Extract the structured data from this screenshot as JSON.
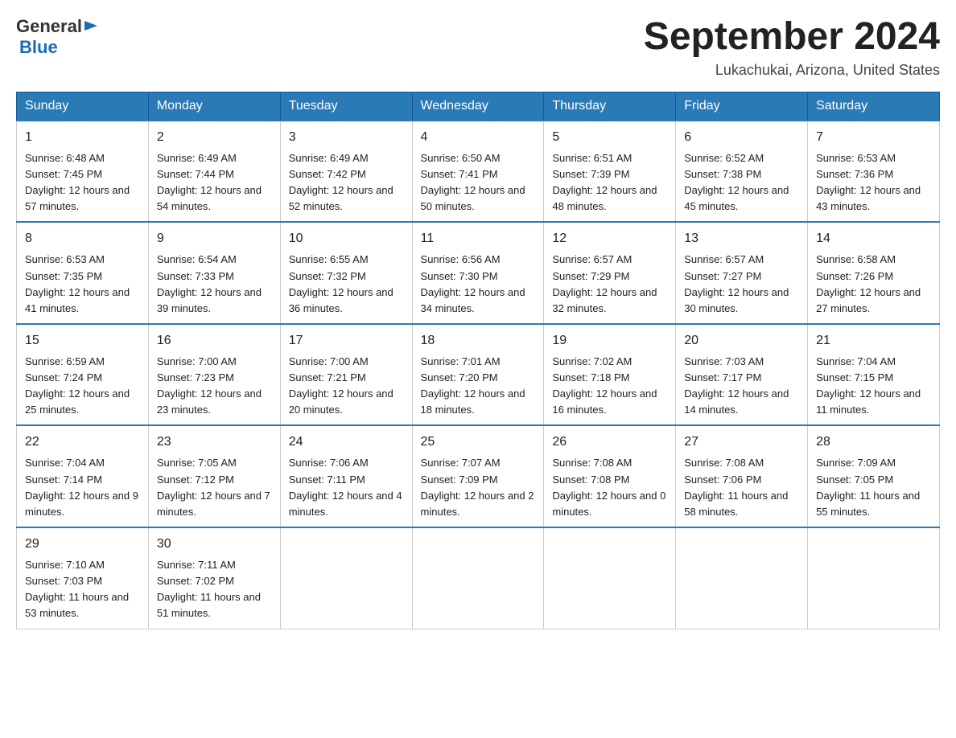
{
  "header": {
    "logo_general": "General",
    "logo_blue": "Blue",
    "title": "September 2024",
    "subtitle": "Lukachukai, Arizona, United States"
  },
  "weekdays": [
    "Sunday",
    "Monday",
    "Tuesday",
    "Wednesday",
    "Thursday",
    "Friday",
    "Saturday"
  ],
  "weeks": [
    [
      {
        "day": "1",
        "sunrise": "Sunrise: 6:48 AM",
        "sunset": "Sunset: 7:45 PM",
        "daylight": "Daylight: 12 hours and 57 minutes."
      },
      {
        "day": "2",
        "sunrise": "Sunrise: 6:49 AM",
        "sunset": "Sunset: 7:44 PM",
        "daylight": "Daylight: 12 hours and 54 minutes."
      },
      {
        "day": "3",
        "sunrise": "Sunrise: 6:49 AM",
        "sunset": "Sunset: 7:42 PM",
        "daylight": "Daylight: 12 hours and 52 minutes."
      },
      {
        "day": "4",
        "sunrise": "Sunrise: 6:50 AM",
        "sunset": "Sunset: 7:41 PM",
        "daylight": "Daylight: 12 hours and 50 minutes."
      },
      {
        "day": "5",
        "sunrise": "Sunrise: 6:51 AM",
        "sunset": "Sunset: 7:39 PM",
        "daylight": "Daylight: 12 hours and 48 minutes."
      },
      {
        "day": "6",
        "sunrise": "Sunrise: 6:52 AM",
        "sunset": "Sunset: 7:38 PM",
        "daylight": "Daylight: 12 hours and 45 minutes."
      },
      {
        "day": "7",
        "sunrise": "Sunrise: 6:53 AM",
        "sunset": "Sunset: 7:36 PM",
        "daylight": "Daylight: 12 hours and 43 minutes."
      }
    ],
    [
      {
        "day": "8",
        "sunrise": "Sunrise: 6:53 AM",
        "sunset": "Sunset: 7:35 PM",
        "daylight": "Daylight: 12 hours and 41 minutes."
      },
      {
        "day": "9",
        "sunrise": "Sunrise: 6:54 AM",
        "sunset": "Sunset: 7:33 PM",
        "daylight": "Daylight: 12 hours and 39 minutes."
      },
      {
        "day": "10",
        "sunrise": "Sunrise: 6:55 AM",
        "sunset": "Sunset: 7:32 PM",
        "daylight": "Daylight: 12 hours and 36 minutes."
      },
      {
        "day": "11",
        "sunrise": "Sunrise: 6:56 AM",
        "sunset": "Sunset: 7:30 PM",
        "daylight": "Daylight: 12 hours and 34 minutes."
      },
      {
        "day": "12",
        "sunrise": "Sunrise: 6:57 AM",
        "sunset": "Sunset: 7:29 PM",
        "daylight": "Daylight: 12 hours and 32 minutes."
      },
      {
        "day": "13",
        "sunrise": "Sunrise: 6:57 AM",
        "sunset": "Sunset: 7:27 PM",
        "daylight": "Daylight: 12 hours and 30 minutes."
      },
      {
        "day": "14",
        "sunrise": "Sunrise: 6:58 AM",
        "sunset": "Sunset: 7:26 PM",
        "daylight": "Daylight: 12 hours and 27 minutes."
      }
    ],
    [
      {
        "day": "15",
        "sunrise": "Sunrise: 6:59 AM",
        "sunset": "Sunset: 7:24 PM",
        "daylight": "Daylight: 12 hours and 25 minutes."
      },
      {
        "day": "16",
        "sunrise": "Sunrise: 7:00 AM",
        "sunset": "Sunset: 7:23 PM",
        "daylight": "Daylight: 12 hours and 23 minutes."
      },
      {
        "day": "17",
        "sunrise": "Sunrise: 7:00 AM",
        "sunset": "Sunset: 7:21 PM",
        "daylight": "Daylight: 12 hours and 20 minutes."
      },
      {
        "day": "18",
        "sunrise": "Sunrise: 7:01 AM",
        "sunset": "Sunset: 7:20 PM",
        "daylight": "Daylight: 12 hours and 18 minutes."
      },
      {
        "day": "19",
        "sunrise": "Sunrise: 7:02 AM",
        "sunset": "Sunset: 7:18 PM",
        "daylight": "Daylight: 12 hours and 16 minutes."
      },
      {
        "day": "20",
        "sunrise": "Sunrise: 7:03 AM",
        "sunset": "Sunset: 7:17 PM",
        "daylight": "Daylight: 12 hours and 14 minutes."
      },
      {
        "day": "21",
        "sunrise": "Sunrise: 7:04 AM",
        "sunset": "Sunset: 7:15 PM",
        "daylight": "Daylight: 12 hours and 11 minutes."
      }
    ],
    [
      {
        "day": "22",
        "sunrise": "Sunrise: 7:04 AM",
        "sunset": "Sunset: 7:14 PM",
        "daylight": "Daylight: 12 hours and 9 minutes."
      },
      {
        "day": "23",
        "sunrise": "Sunrise: 7:05 AM",
        "sunset": "Sunset: 7:12 PM",
        "daylight": "Daylight: 12 hours and 7 minutes."
      },
      {
        "day": "24",
        "sunrise": "Sunrise: 7:06 AM",
        "sunset": "Sunset: 7:11 PM",
        "daylight": "Daylight: 12 hours and 4 minutes."
      },
      {
        "day": "25",
        "sunrise": "Sunrise: 7:07 AM",
        "sunset": "Sunset: 7:09 PM",
        "daylight": "Daylight: 12 hours and 2 minutes."
      },
      {
        "day": "26",
        "sunrise": "Sunrise: 7:08 AM",
        "sunset": "Sunset: 7:08 PM",
        "daylight": "Daylight: 12 hours and 0 minutes."
      },
      {
        "day": "27",
        "sunrise": "Sunrise: 7:08 AM",
        "sunset": "Sunset: 7:06 PM",
        "daylight": "Daylight: 11 hours and 58 minutes."
      },
      {
        "day": "28",
        "sunrise": "Sunrise: 7:09 AM",
        "sunset": "Sunset: 7:05 PM",
        "daylight": "Daylight: 11 hours and 55 minutes."
      }
    ],
    [
      {
        "day": "29",
        "sunrise": "Sunrise: 7:10 AM",
        "sunset": "Sunset: 7:03 PM",
        "daylight": "Daylight: 11 hours and 53 minutes."
      },
      {
        "day": "30",
        "sunrise": "Sunrise: 7:11 AM",
        "sunset": "Sunset: 7:02 PM",
        "daylight": "Daylight: 11 hours and 51 minutes."
      },
      null,
      null,
      null,
      null,
      null
    ]
  ]
}
